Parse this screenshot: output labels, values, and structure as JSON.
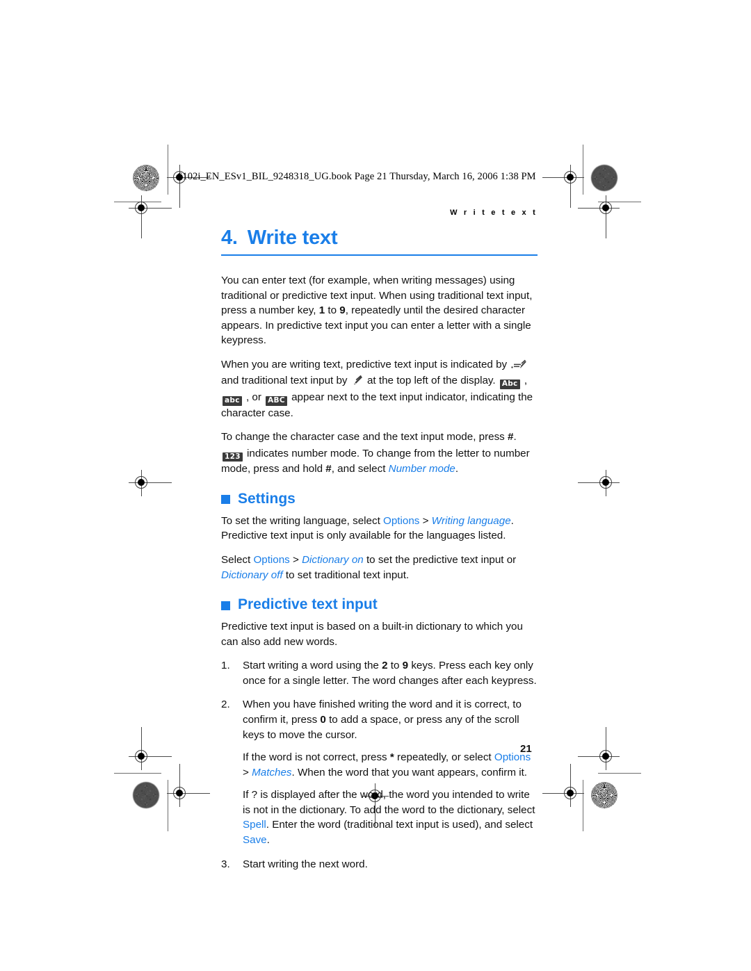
{
  "slug": {
    "text": "6102i_EN_ESv1_BIL_9248318_UG.book  Page 21  Thursday, March 16, 2006  1:38 PM"
  },
  "colors": {
    "accent_blue": "#1a7ee8",
    "badge_gray": "#3b3b3b",
    "body_text": "#111111"
  },
  "header": {
    "running_head": "W r i t e   t e x t"
  },
  "chapter": {
    "number": "4.",
    "title": "Write text"
  },
  "intro": {
    "p1_a": "You can enter text (for example, when writing messages) using traditional or predictive text input. When using traditional text input, press a number key, ",
    "p1_key1": "1",
    "p1_b": " to ",
    "p1_key9": "9",
    "p1_c": ", repeatedly until the desired character appears. In predictive text input you can enter a letter with a single keypress.",
    "p2_a": "When you are writing text, predictive text input is indicated by ",
    "p2_icon1": "predictive-pen-icon",
    "p2_b": " and traditional text input by ",
    "p2_icon2": "traditional-pen-icon",
    "p2_c": " at the top left of the display. ",
    "p2_badge_abc_upperfirst": "Abc",
    "p2_sep1": " , ",
    "p2_badge_abc_lower": "abc",
    "p2_d": " , or ",
    "p2_badge_abc_upper": "ABC",
    "p2_e": " appear next to the text input indicator, indicating the character case.",
    "p3_a": "To change the character case and the text input mode, press ",
    "p3_hash": "#",
    "p3_b": ".",
    "p4_badge_123": "123",
    "p4_a": " indicates number mode. To change from the letter to number mode, press and hold ",
    "p4_hash": "#",
    "p4_b": ", and select ",
    "p4_number_mode": "Number mode",
    "p4_c": "."
  },
  "settings": {
    "heading": "Settings",
    "p1_a": "To set the writing language, select ",
    "p1_options": "Options",
    "p1_b": " > ",
    "p1_writing_language": "Writing language",
    "p1_c": ".",
    "p1_d": "Predictive text input is only available for the languages listed.",
    "p2_a": "Select ",
    "p2_options": "Options",
    "p2_b": " > ",
    "p2_dict_on": "Dictionary on",
    "p2_c": " to set the predictive text input or ",
    "p2_dict_off": "Dictionary off",
    "p2_d": " to set traditional text input."
  },
  "predictive": {
    "heading": "Predictive text input",
    "intro": "Predictive text input is based on a built-in dictionary to which you can also add new words.",
    "steps": [
      {
        "marker": "1.",
        "p1_a": "Start writing a word using the ",
        "p1_key_a": "2",
        "p1_b": " to ",
        "p1_key_b": "9",
        "p1_c": " keys. Press each key only once for a single letter. The word changes after each keypress."
      },
      {
        "marker": "2.",
        "p1_a": "When you have finished writing the word and it is correct, to confirm it, press ",
        "p1_key": "0",
        "p1_b": " to add a space, or press any of the scroll keys to move the cursor.",
        "p2_a": "If the word is not correct, press ",
        "p2_star": "*",
        "p2_b": " repeatedly, or select ",
        "p2_options": "Options",
        "p2_c": " > ",
        "p2_matches": "Matches",
        "p2_d": ". When the word that you want appears, confirm it.",
        "p3_a": "If ? is displayed after the word, the word you intended to write is not in the dictionary. To add the word to the dictionary, select ",
        "p3_spell": "Spell",
        "p3_b": ". Enter the word (traditional text input is used), and select ",
        "p3_save": "Save",
        "p3_c": "."
      },
      {
        "marker": "3.",
        "p1_a": "Start writing the next word."
      }
    ]
  },
  "footer": {
    "page_number": "21"
  }
}
